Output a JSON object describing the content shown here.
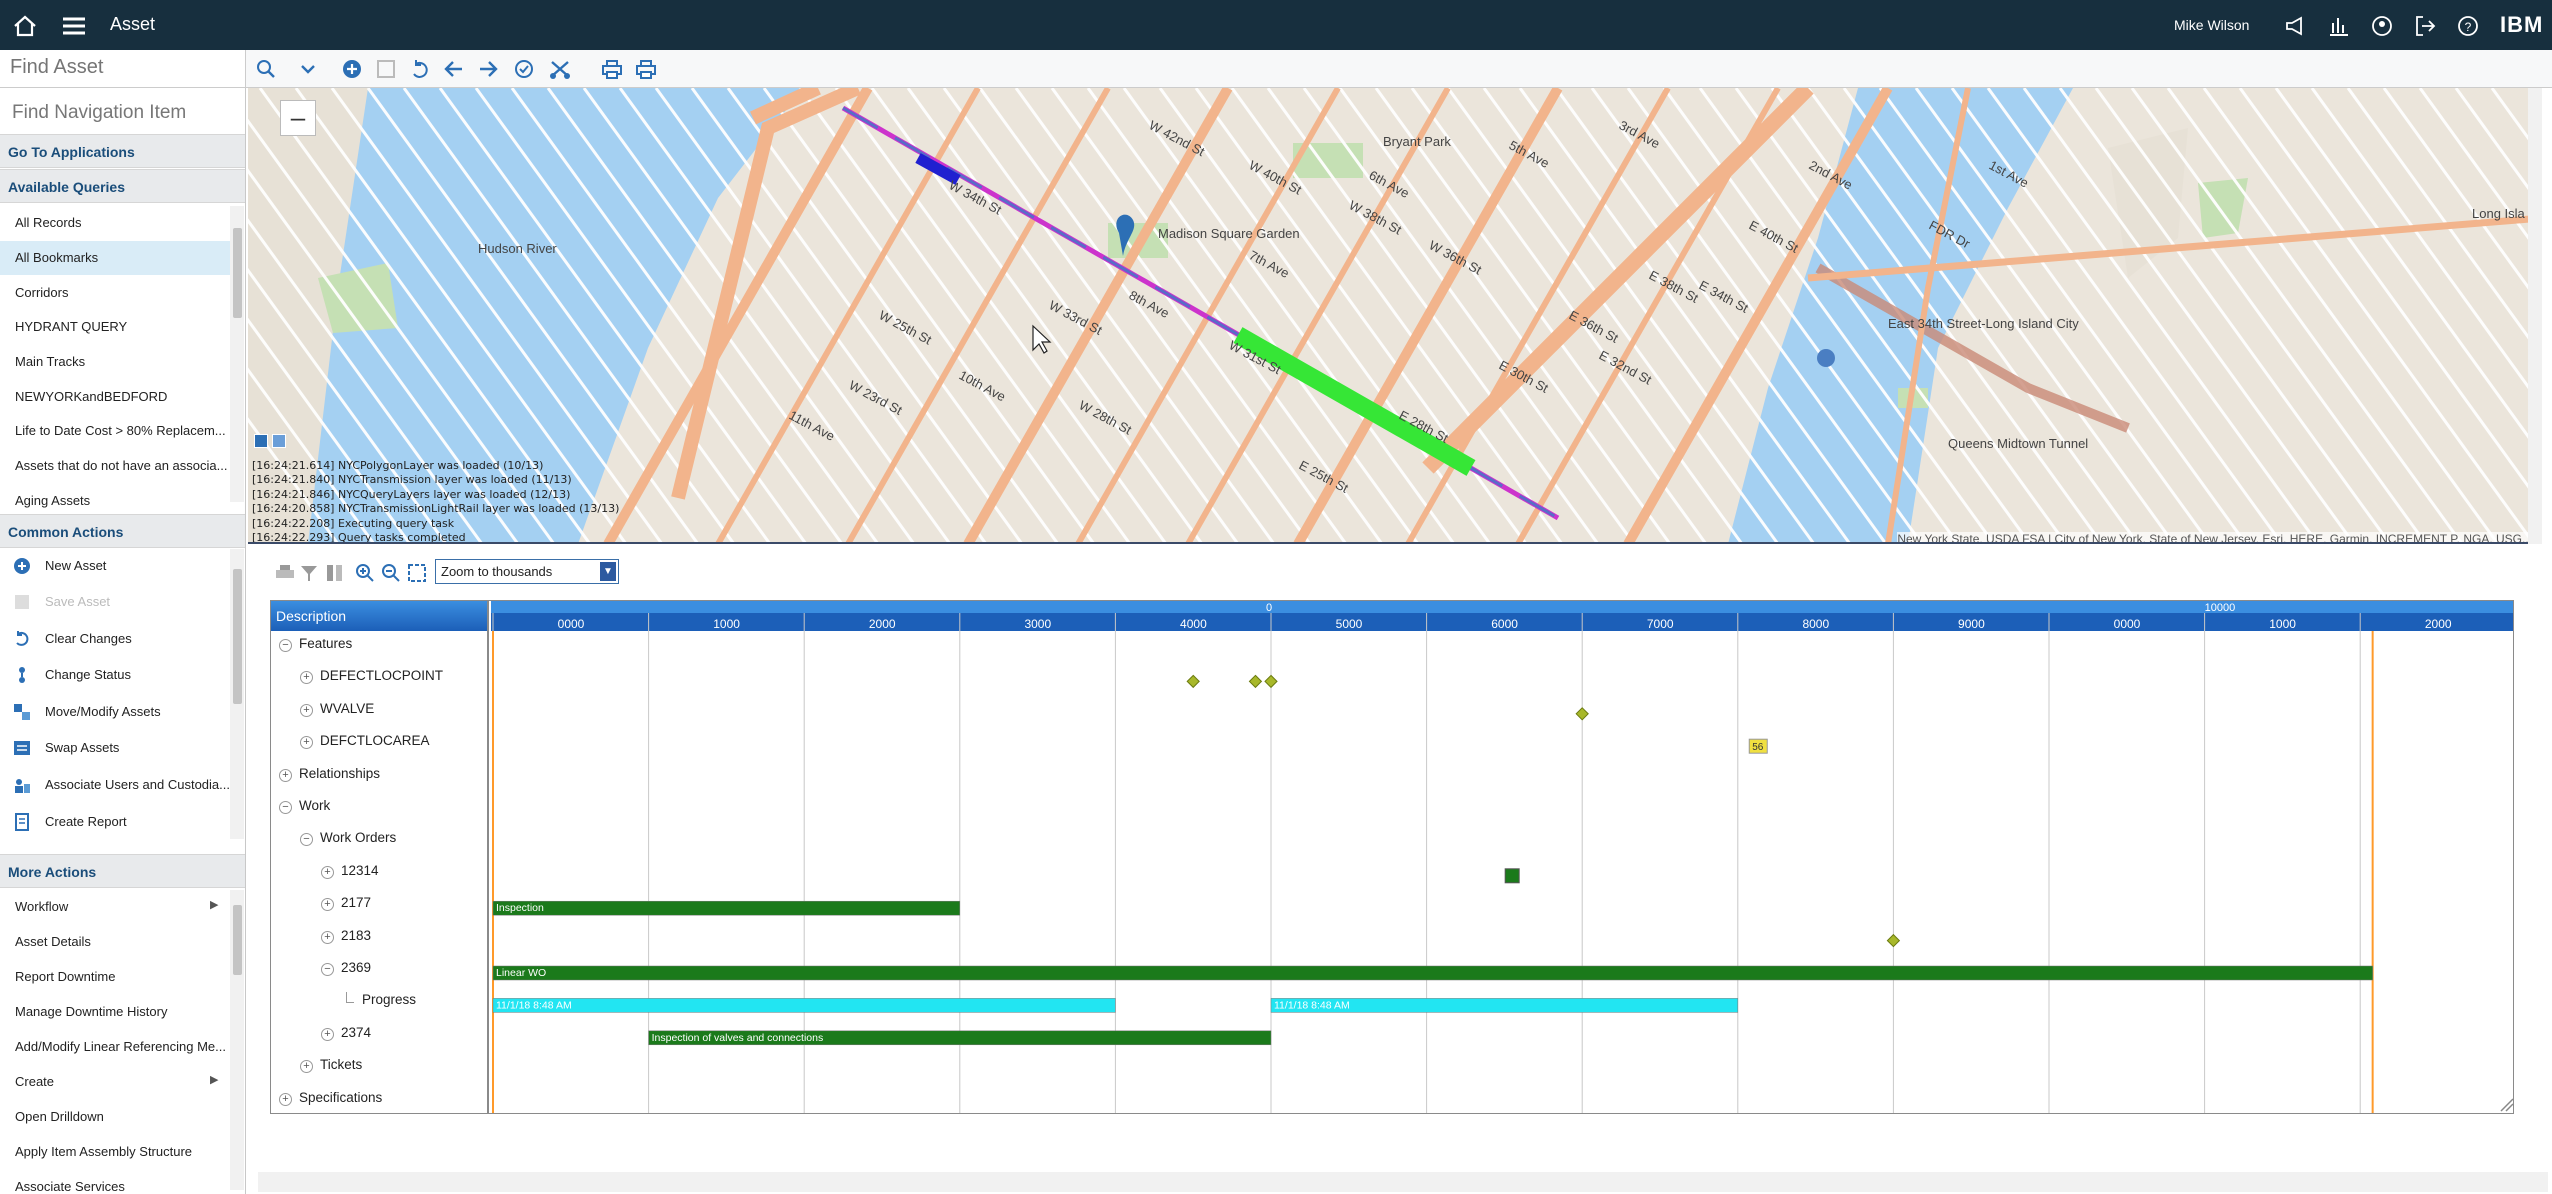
{
  "topbar": {
    "app_title": "Asset",
    "user": "Mike Wilson",
    "brand": "IBM",
    "icons": [
      "home-icon",
      "menu-icon",
      "announce-icon",
      "chart-icon",
      "profile-icon",
      "logout-icon",
      "help-icon"
    ]
  },
  "find_asset": {
    "placeholder": "Find Asset"
  },
  "sidebar": {
    "find_nav": "Find Navigation Item",
    "go_to_apps": "Go To Applications",
    "queries_title": "Available Queries",
    "queries": [
      "All Records",
      "All Bookmarks",
      "Corridors",
      "HYDRANT QUERY",
      "Main Tracks",
      "NEWYORKandBEDFORD",
      "Life to Date Cost > 80% Replacem...",
      "Assets that do not have an associa...",
      "Aging Assets"
    ],
    "common_title": "Common Actions",
    "common": [
      {
        "label": "New Asset",
        "icon": "plus-circle-icon",
        "enabled": true
      },
      {
        "label": "Save Asset",
        "icon": "save-icon",
        "enabled": false
      },
      {
        "label": "Clear Changes",
        "icon": "undo-icon",
        "enabled": true
      },
      {
        "label": "Change Status",
        "icon": "status-icon",
        "enabled": true
      },
      {
        "label": "Move/Modify Assets",
        "icon": "move-icon",
        "enabled": true
      },
      {
        "label": "Swap Assets",
        "icon": "swap-icon",
        "enabled": true
      },
      {
        "label": "Associate Users and Custodia...",
        "icon": "users-icon",
        "enabled": true
      },
      {
        "label": "Create Report",
        "icon": "report-icon",
        "enabled": true
      }
    ],
    "more_title": "More Actions",
    "more": [
      "Workflow",
      "Asset Details",
      "Report Downtime",
      "Manage Downtime History",
      "Add/Modify Linear Referencing Me...",
      "Create",
      "Open Drilldown",
      "Apply Item Assembly Structure",
      "Associate Services"
    ]
  },
  "map": {
    "log_lines": [
      "[16:24:21.614] NYCPolygonLayer was loaded (10/13)",
      "[16:24:21.840] NYCTransmission layer was loaded (11/13)",
      "[16:24:21.846] NYCQueryLayers layer was loaded (12/13)",
      "[16:24:20.858] NYCTransmissionLightRail layer was loaded (13/13)",
      "[16:24:22.208] Executing query task",
      "[16:24:22.293] Query tasks completed"
    ],
    "attribution": "New York State, USDA FSA | City of New York, State of New Jersey, Esri, HERE, Garmin, INCREMENT P, NGA, USG...",
    "place_labels": [
      "Hudson River",
      "Long Isla City",
      "Madison Square Garden",
      "East 34th Street-Long Island City",
      "Bryant Park",
      "Queens Midtown Tunnel",
      "FDR Dr",
      "1st Ave",
      "2nd Ave",
      "3rd Ave",
      "5th Ave",
      "6th Ave",
      "7th Ave",
      "8th Ave",
      "10th Ave",
      "11th Ave",
      "W 34th St",
      "W 33rd St",
      "W 31st St",
      "W 28th St",
      "W 25th St",
      "W 23rd St",
      "E 34th St",
      "E 32nd St",
      "E 30th St",
      "E 28th St",
      "E 25th St",
      "W 42nd St",
      "W 40th St",
      "W 38th St",
      "W 36th St",
      "E 40th St",
      "E 38th St",
      "E 36th St"
    ]
  },
  "gantt": {
    "zoom_label": "Zoom to thousands",
    "description_header": "Description",
    "axis_marker_top": "0",
    "axis_marker_right": "10000",
    "ticks": [
      "0000",
      "1000",
      "2000",
      "3000",
      "4000",
      "5000",
      "6000",
      "7000",
      "8000",
      "9000",
      "0000",
      "1000",
      "2000"
    ],
    "rows": [
      "Features",
      "DEFECTLOCPOINT",
      "WVALVE",
      "DEFCTLOCAREA",
      "Relationships",
      "Work",
      "Work Orders",
      "12314",
      "2177",
      "2183",
      "2369",
      "Progress",
      "2374",
      "Tickets",
      "Specifications"
    ],
    "bars": [
      {
        "label": "Inspection",
        "color": "#1b7a1b",
        "start": 0,
        "end": 3000,
        "row": 8
      },
      {
        "label": "Linear WO",
        "color": "#1b7a1b",
        "start": 0,
        "end": 12080,
        "row": 10
      },
      {
        "label": "11/1/18 8:48 AM",
        "color": "#22e5f2",
        "start": 0,
        "end": 4000,
        "row": 11
      },
      {
        "label": "11/1/18 8:48 AM",
        "color": "#22e5f2",
        "start": 5000,
        "end": 8000,
        "row": 11
      },
      {
        "label": "Inspection of valves and connections",
        "color": "#1b7a1b",
        "start": 1000,
        "end": 5000,
        "row": 12
      }
    ],
    "markers": [
      {
        "type": "diamond",
        "at": 4500,
        "row": 1
      },
      {
        "type": "diamond",
        "at": 4900,
        "row": 1
      },
      {
        "type": "diamond",
        "at": 5000,
        "row": 1
      },
      {
        "type": "diamond",
        "at": 7000,
        "row": 2
      },
      {
        "type": "badge",
        "label": "56",
        "at": 8080,
        "row": 3
      },
      {
        "type": "square",
        "at": 6550,
        "row": 7
      },
      {
        "type": "diamond",
        "at": 9000,
        "row": 9
      }
    ],
    "colors": {
      "header_blue": "#1c5fb8",
      "orange_line": "#ff9a2a"
    }
  }
}
